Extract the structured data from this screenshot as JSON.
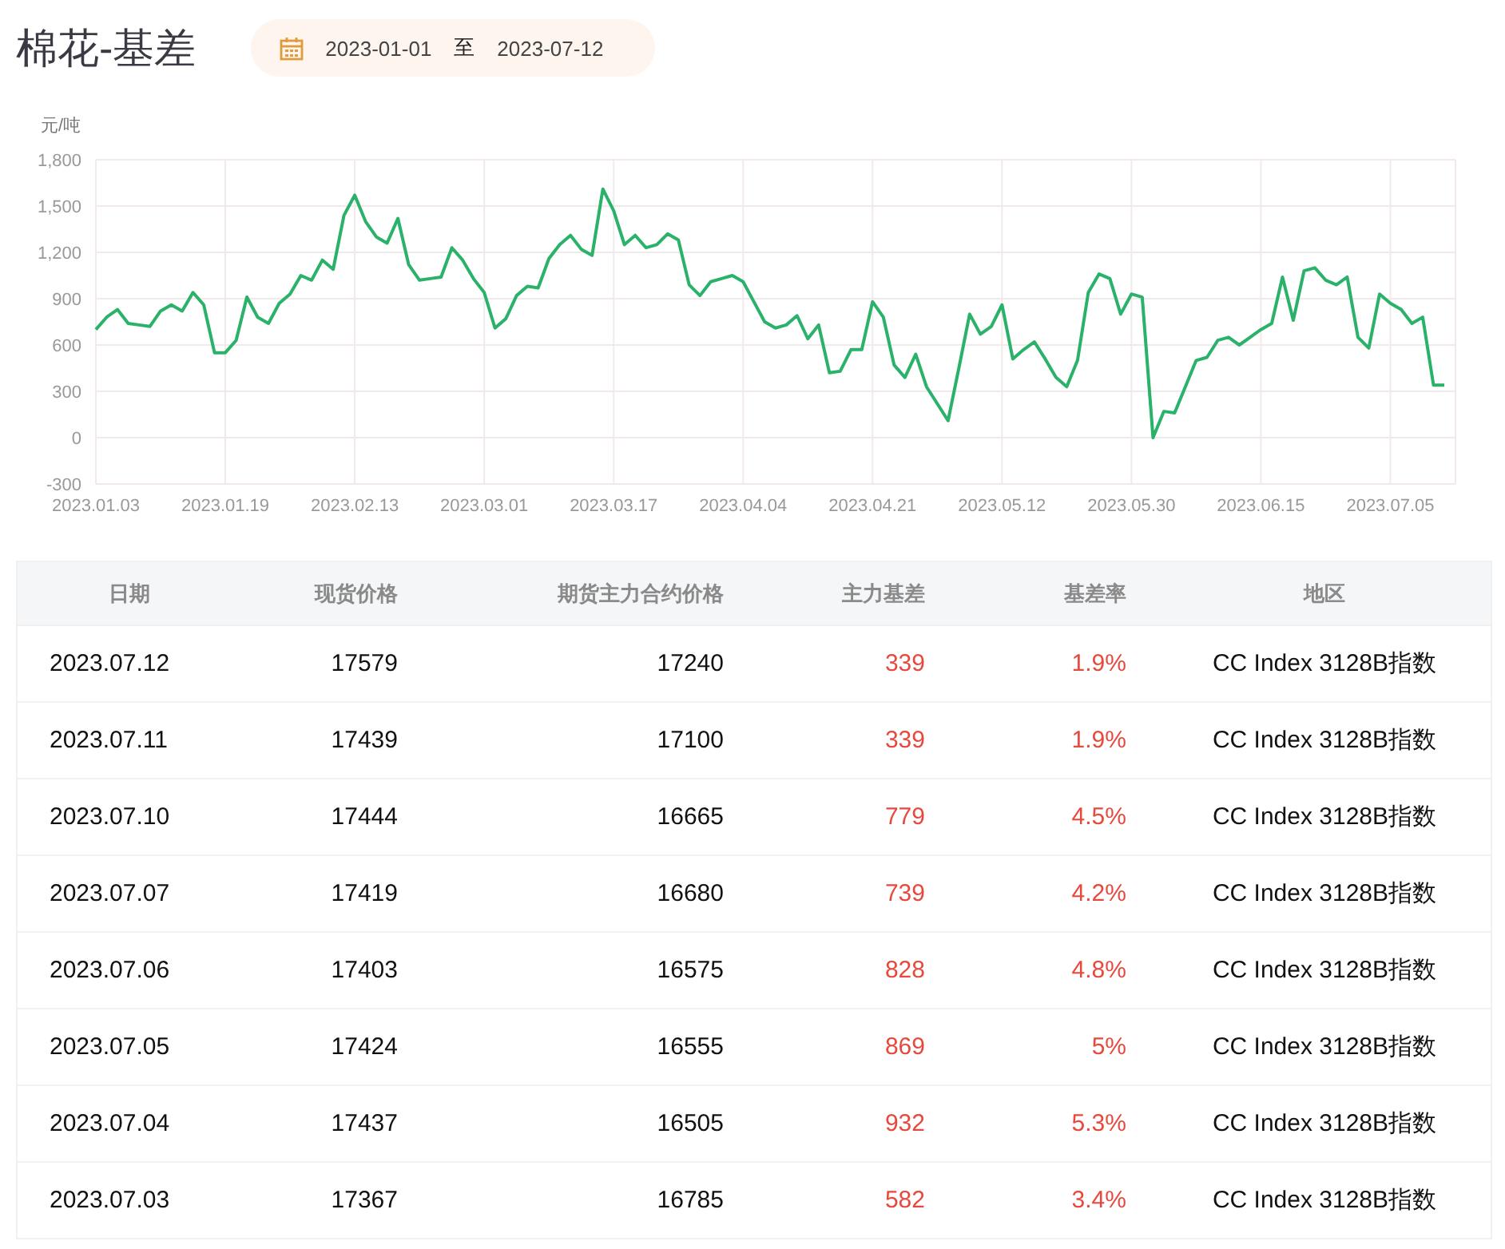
{
  "title": "棉花-基差",
  "date_range": {
    "start": "2023-01-01",
    "separator": "至",
    "end": "2023-07-12"
  },
  "chart": {
    "chart_data": {
      "type": "line",
      "ylabel": "元/吨",
      "categories": [
        "2023.01.03",
        null,
        null,
        null,
        null,
        null,
        null,
        null,
        null,
        null,
        null,
        null,
        "2023.01.19",
        null,
        null,
        null,
        null,
        null,
        null,
        null,
        null,
        null,
        null,
        null,
        "2023.02.13",
        null,
        null,
        null,
        null,
        null,
        null,
        null,
        null,
        null,
        null,
        null,
        "2023.03.01",
        null,
        null,
        null,
        null,
        null,
        null,
        null,
        null,
        null,
        null,
        null,
        "2023.03.17",
        null,
        null,
        null,
        null,
        null,
        null,
        null,
        null,
        null,
        null,
        null,
        "2023.04.04",
        null,
        null,
        null,
        null,
        null,
        null,
        null,
        null,
        null,
        null,
        null,
        "2023.04.21",
        null,
        null,
        null,
        null,
        null,
        null,
        null,
        null,
        null,
        null,
        null,
        "2023.05.12",
        null,
        null,
        null,
        null,
        null,
        null,
        null,
        null,
        null,
        null,
        null,
        "2023.05.30",
        null,
        null,
        null,
        null,
        null,
        null,
        null,
        null,
        null,
        null,
        null,
        "2023.06.15",
        null,
        null,
        null,
        null,
        null,
        null,
        null,
        null,
        null,
        null,
        null,
        "2023.07.05",
        null,
        null,
        null,
        null,
        null
      ],
      "series": [
        {
          "color": "#2bb26a",
          "values": [
            700,
            780,
            830,
            740,
            730,
            720,
            820,
            860,
            820,
            940,
            860,
            550,
            550,
            630,
            910,
            780,
            740,
            870,
            930,
            1050,
            1020,
            1150,
            1090,
            1440,
            1570,
            1400,
            1300,
            1260,
            1420,
            1120,
            1020,
            1030,
            1040,
            1230,
            1150,
            1030,
            940,
            710,
            770,
            920,
            980,
            970,
            1160,
            1250,
            1310,
            1220,
            1180,
            1610,
            1470,
            1250,
            1310,
            1230,
            1250,
            1320,
            1280,
            990,
            920,
            1010,
            1030,
            1050,
            1010,
            880,
            750,
            710,
            730,
            790,
            640,
            730,
            420,
            430,
            570,
            570,
            880,
            780,
            470,
            390,
            540,
            330,
            220,
            110,
            450,
            800,
            670,
            720,
            860,
            510,
            570,
            620,
            510,
            390,
            330,
            500,
            940,
            1060,
            1030,
            800,
            930,
            910,
            0,
            170,
            160,
            330,
            500,
            520,
            630,
            650,
            600,
            650,
            700,
            740,
            1040,
            760,
            1080,
            1100,
            1020,
            990,
            1040,
            650,
            580,
            930,
            870,
            830,
            740,
            780,
            340,
            340
          ]
        }
      ],
      "grid": true,
      "ylim": [
        -300,
        1800
      ],
      "yticks": [
        {
          "value": -300,
          "label": "-300"
        },
        {
          "value": 0,
          "label": "0"
        },
        {
          "value": 300,
          "label": "300"
        },
        {
          "value": 600,
          "label": "600"
        },
        {
          "value": 900,
          "label": "900"
        },
        {
          "value": 1200,
          "label": "1,200"
        },
        {
          "value": 1500,
          "label": "1,500"
        },
        {
          "value": 1800,
          "label": "1,800"
        }
      ]
    }
  },
  "table": {
    "columns": [
      "日期",
      "现货价格",
      "期货主力合约价格",
      "主力基差",
      "基差率",
      "地区"
    ],
    "rows": [
      [
        "2023.07.12",
        "17579",
        "17240",
        "339",
        "1.9%",
        "CC Index 3128B指数"
      ],
      [
        "2023.07.11",
        "17439",
        "17100",
        "339",
        "1.9%",
        "CC Index 3128B指数"
      ],
      [
        "2023.07.10",
        "17444",
        "16665",
        "779",
        "4.5%",
        "CC Index 3128B指数"
      ],
      [
        "2023.07.07",
        "17419",
        "16680",
        "739",
        "4.2%",
        "CC Index 3128B指数"
      ],
      [
        "2023.07.06",
        "17403",
        "16575",
        "828",
        "4.8%",
        "CC Index 3128B指数"
      ],
      [
        "2023.07.05",
        "17424",
        "16555",
        "869",
        "5%",
        "CC Index 3128B指数"
      ],
      [
        "2023.07.04",
        "17437",
        "16505",
        "932",
        "5.3%",
        "CC Index 3128B指数"
      ],
      [
        "2023.07.03",
        "17367",
        "16785",
        "582",
        "3.4%",
        "CC Index 3128B指数"
      ]
    ]
  }
}
